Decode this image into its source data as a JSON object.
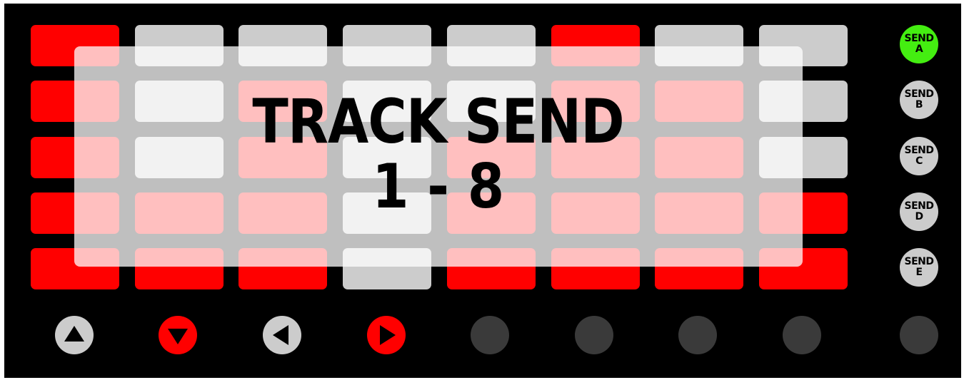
{
  "overlay": {
    "title": "TRACK SEND",
    "range": "1 - 8"
  },
  "colors": {
    "background": "#000000",
    "pad_red": "#ff0000",
    "pad_grey": "#cccccc",
    "send_active": "#44ee11",
    "send_inactive": "#cccccc",
    "nav_red": "#ff0000",
    "nav_grey": "#cccccc",
    "off": "#3a3a3a"
  },
  "pad_grid": {
    "rows": [
      [
        "red",
        "grey",
        "grey",
        "grey",
        "grey",
        "red",
        "grey",
        "grey"
      ],
      [
        "red",
        "grey",
        "red",
        "grey",
        "grey",
        "red",
        "red",
        "grey"
      ],
      [
        "red",
        "grey",
        "red",
        "grey",
        "red",
        "red",
        "red",
        "grey"
      ],
      [
        "red",
        "red",
        "red",
        "grey",
        "red",
        "red",
        "red",
        "red"
      ],
      [
        "red",
        "red",
        "red",
        "grey",
        "red",
        "red",
        "red",
        "red"
      ]
    ]
  },
  "send_buttons": [
    {
      "line1": "SEND",
      "line2": "A",
      "state": "active"
    },
    {
      "line1": "SEND",
      "line2": "B",
      "state": "inactive"
    },
    {
      "line1": "SEND",
      "line2": "C",
      "state": "inactive"
    },
    {
      "line1": "SEND",
      "line2": "D",
      "state": "inactive"
    },
    {
      "line1": "SEND",
      "line2": "E",
      "state": "inactive"
    }
  ],
  "bottom_buttons": [
    {
      "icon": "arrow-up-icon",
      "color": "grey"
    },
    {
      "icon": "arrow-down-icon",
      "color": "red"
    },
    {
      "icon": "arrow-left-icon",
      "color": "grey"
    },
    {
      "icon": "arrow-right-icon",
      "color": "red"
    },
    {
      "icon": "none",
      "color": "off"
    },
    {
      "icon": "none",
      "color": "off"
    },
    {
      "icon": "none",
      "color": "off"
    },
    {
      "icon": "none",
      "color": "off"
    },
    {
      "icon": "none",
      "color": "off"
    }
  ]
}
